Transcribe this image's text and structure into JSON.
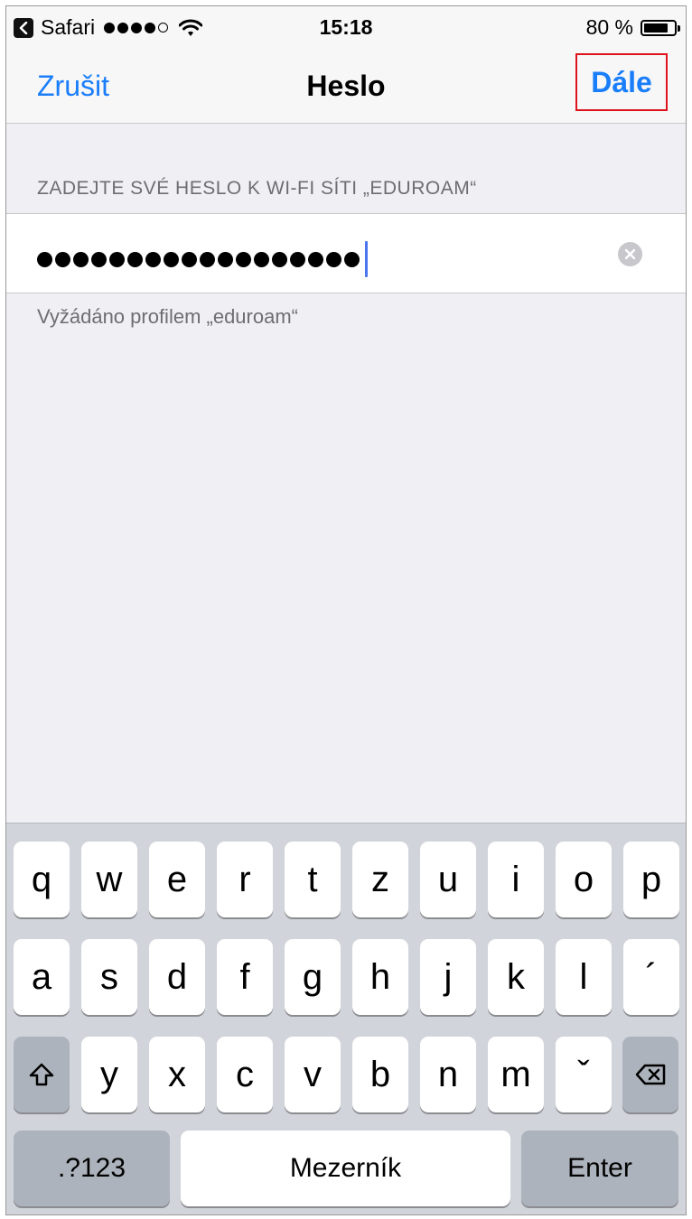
{
  "status_bar": {
    "back_app": "Safari",
    "time": "15:18",
    "battery_text": "80 %",
    "battery_level": 0.8
  },
  "nav": {
    "cancel": "Zrušit",
    "title": "Heslo",
    "next": "Dále"
  },
  "form": {
    "header": "ZADEJTE SVÉ HESLO K WI-FI SÍTI „EDUROAM“",
    "password_length": 18,
    "footer": "Vyžádáno profilem „eduroam“"
  },
  "keyboard": {
    "row1": [
      "q",
      "w",
      "e",
      "r",
      "t",
      "z",
      "u",
      "i",
      "o",
      "p"
    ],
    "row2": [
      "a",
      "s",
      "d",
      "f",
      "g",
      "h",
      "j",
      "k",
      "l",
      "´"
    ],
    "row3": [
      "y",
      "x",
      "c",
      "v",
      "b",
      "n",
      "m",
      "ˇ"
    ],
    "numbers_key": ".?123",
    "space_key": "Mezerník",
    "enter_key": "Enter"
  },
  "colors": {
    "accent": "#1a7efb",
    "highlight_border": "#e0121b",
    "background": "#efeff4",
    "keyboard_bg": "#d1d4da"
  }
}
